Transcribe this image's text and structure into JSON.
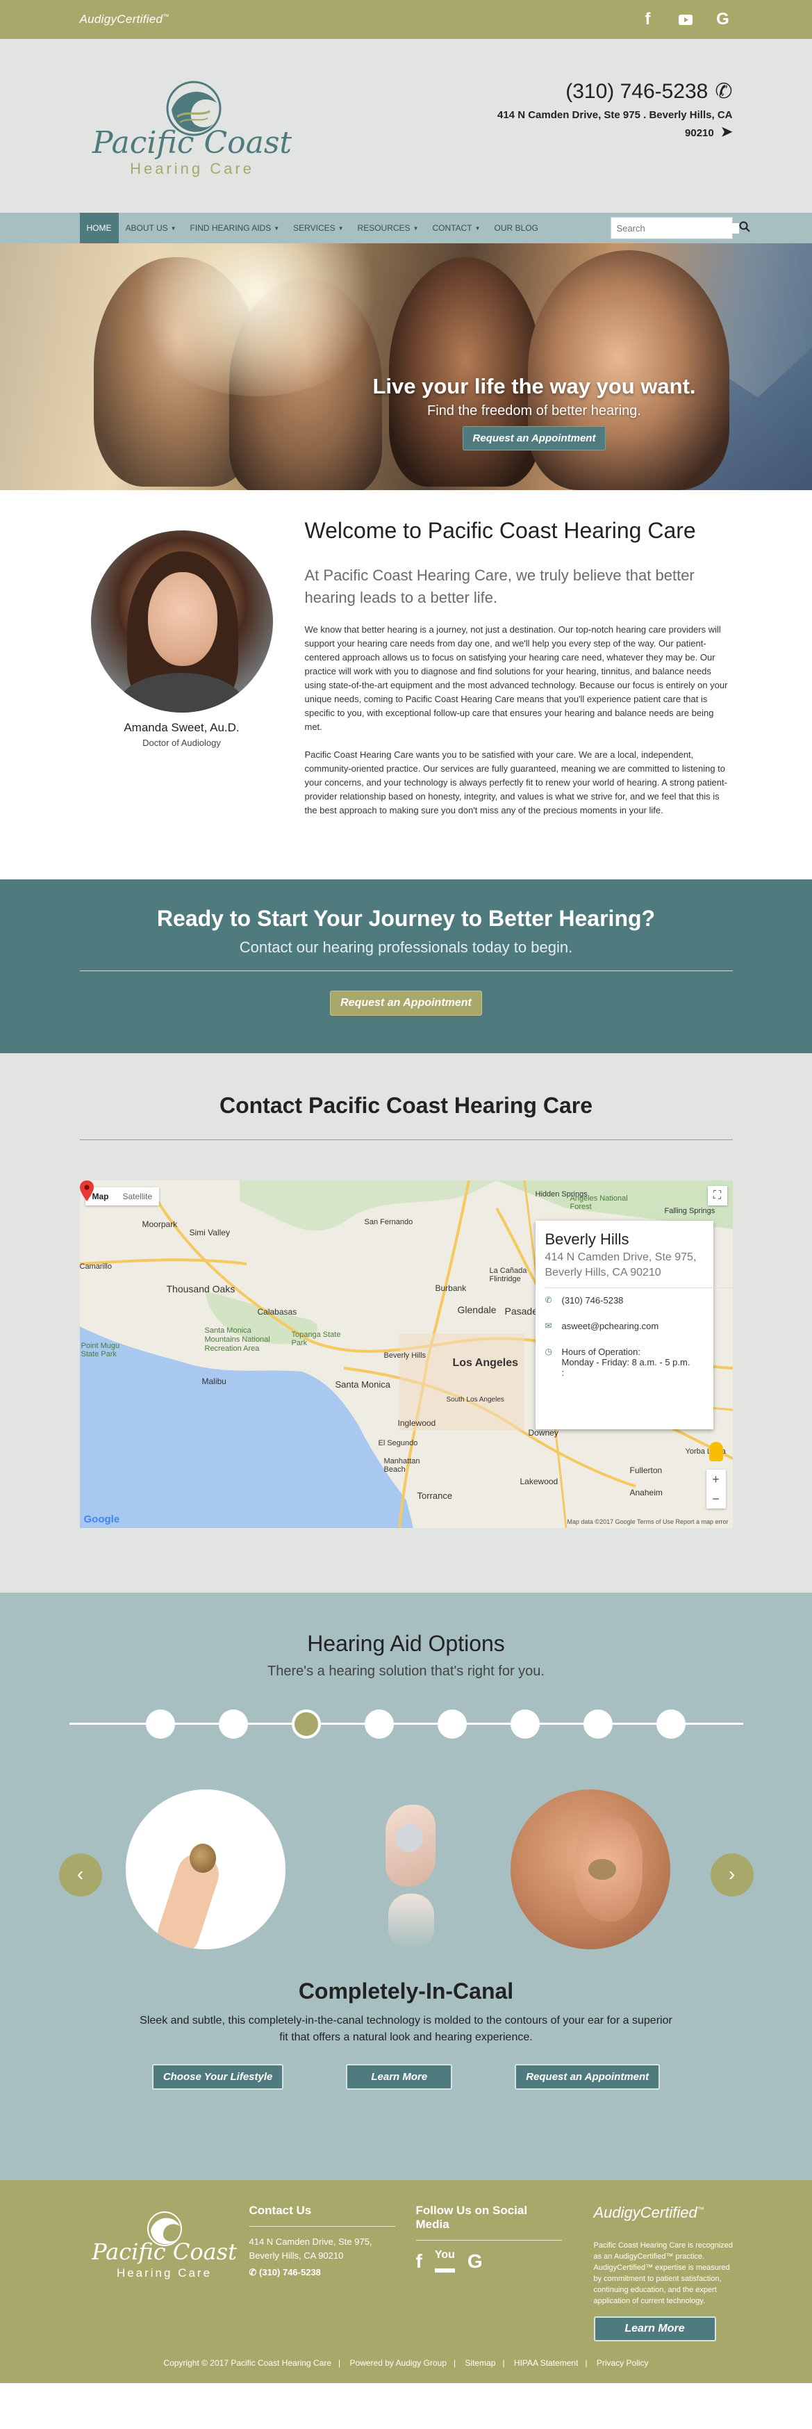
{
  "topbar": {
    "brand": "AudigyCertified",
    "brand_mark": "™",
    "social": [
      "f",
      "▶",
      "G"
    ]
  },
  "header": {
    "logo_line1": "Pacific Coast",
    "logo_line2": "Hearing Care",
    "phone": "(310) 746-5238",
    "address_line1": "414 N Camden Drive, Ste 975 . Beverly Hills, CA",
    "address_line2": "90210"
  },
  "nav": {
    "items": [
      "HOME",
      "ABOUT US",
      "FIND HEARING AIDS",
      "SERVICES",
      "RESOURCES",
      "CONTACT",
      "OUR BLOG"
    ],
    "search_placeholder": "Search"
  },
  "hero": {
    "headline": "Live your life the way you want.",
    "subline": "Find the freedom of better hearing.",
    "button": "Request an Appointment"
  },
  "welcome": {
    "title": "Welcome to Pacific Coast Hearing Care",
    "lead": "At Pacific Coast Hearing Care, we truly believe that better hearing leads to a better life.",
    "para1": "We know that better hearing is a journey, not just a destination. Our top-notch hearing care providers will support your hearing care needs from day one, and we'll help you every step of the way. Our patient-centered approach allows us to focus on satisfying your hearing care need, whatever they may be. Our practice will work with you to diagnose and find solutions for your hearing, tinnitus, and balance needs using state-of-the-art equipment and the most advanced technology. Because our focus is entirely on your unique needs, coming to Pacific Coast Hearing Care means that you'll experience patient care that is specific to you, with exceptional follow-up care that ensures your hearing and balance needs are being met.",
    "para2": "Pacific Coast Hearing Care wants you to be satisfied with your care. We are a local, independent, community-oriented practice. Our services are fully guaranteed, meaning we are committed to listening to your concerns, and your technology is always perfectly fit to renew your world of hearing. A strong patient-provider relationship based on honesty, integrity, and values is what we strive for, and we feel that this is the best approach to making sure you don't miss any of the precious moments in your life.",
    "doctor_name": "Amanda Sweet, Au.D.",
    "doctor_title": "Doctor of Audiology"
  },
  "cta": {
    "title": "Ready to Start Your Journey to Better Hearing?",
    "subtitle": "Contact our hearing professionals today to begin.",
    "button": "Request an Appointment"
  },
  "contact": {
    "title": "Contact Pacific Coast Hearing Care",
    "map": {
      "tab_map": "Map",
      "tab_satellite": "Satellite",
      "place_name": "Beverly Hills",
      "place_address": "414 N Camden Drive, Ste 975, Beverly Hills, CA 90210",
      "phone": "(310) 746-5238",
      "email": "asweet@pchearing.com",
      "hours_label": "Hours of Operation:",
      "hours": "Monday - Friday: 8 a.m. - 5 p.m.",
      "hours_extra": ":",
      "labels": [
        "Simi Valley",
        "Moorpark",
        "Thousand Oaks",
        "Calabasas",
        "Santa Monica Mountains National Recreation Area",
        "Topanga State Park",
        "Malibu",
        "Santa Monica",
        "Beverly Hills",
        "Los Angeles",
        "Glendale",
        "Burbank",
        "Pasadena",
        "La Cañada Flintridge",
        "Inglewood",
        "El Segundo",
        "Manhattan Beach",
        "Torrance",
        "Lakewood",
        "Fullerton",
        "Anaheim",
        "Hidden Springs",
        "Angeles National Forest",
        "Falling Springs",
        "San Fernando",
        "Point Mugu State Park",
        "Camarillo",
        "South Los Angeles",
        "Downey",
        "Yorba Linda"
      ],
      "zoom_in": "+",
      "zoom_out": "−",
      "google": "Google",
      "footer": "Map data ©2017 Google   Terms of Use   Report a map error"
    }
  },
  "options": {
    "title": "Hearing Aid Options",
    "subtitle": "There's a hearing solution that's right for you.",
    "step_count": 8,
    "active_step": 3,
    "product_title": "Completely-In-Canal",
    "product_desc": "Sleek and subtle, this completely-in-the-canal technology is molded to the contours of your ear for a superior fit that offers a natural look and hearing experience.",
    "buttons": [
      "Choose Your Lifestyle",
      "Learn More",
      "Request an Appointment"
    ],
    "prev": "‹",
    "next": "›"
  },
  "footer": {
    "logo_line1": "Pacific Coast",
    "logo_line2": "Hearing Care",
    "contact_title": "Contact Us",
    "address1": "414 N Camden Drive, Ste 975,",
    "address2": "Beverly Hills, CA 90210",
    "phone": "(310) 746-5238",
    "social_title": "Follow Us on Social Media",
    "social": [
      "f",
      "You",
      "G"
    ],
    "audigy": "AudigyCertified",
    "audigy_mark": "™",
    "audigy_text": "Pacific Coast Hearing Care is recognized as an AudigyCertified™ practice. AudigyCertified™ expertise is measured by commitment to patient satisfaction, continuing education, and the expert application of current technology.",
    "learn_more": "Learn More",
    "copyright": "Copyright © 2017 Pacific Coast Hearing Care",
    "powered": "Powered by Audigy Group",
    "sitemap": "Sitemap",
    "hipaa": "HIPAA Statement",
    "privacy": "Privacy Policy"
  },
  "colors": {
    "olive": "#a9a86b",
    "teal": "#4f7b7e",
    "light_teal": "#a8bfc1",
    "light_gray": "#e1e4e1"
  }
}
